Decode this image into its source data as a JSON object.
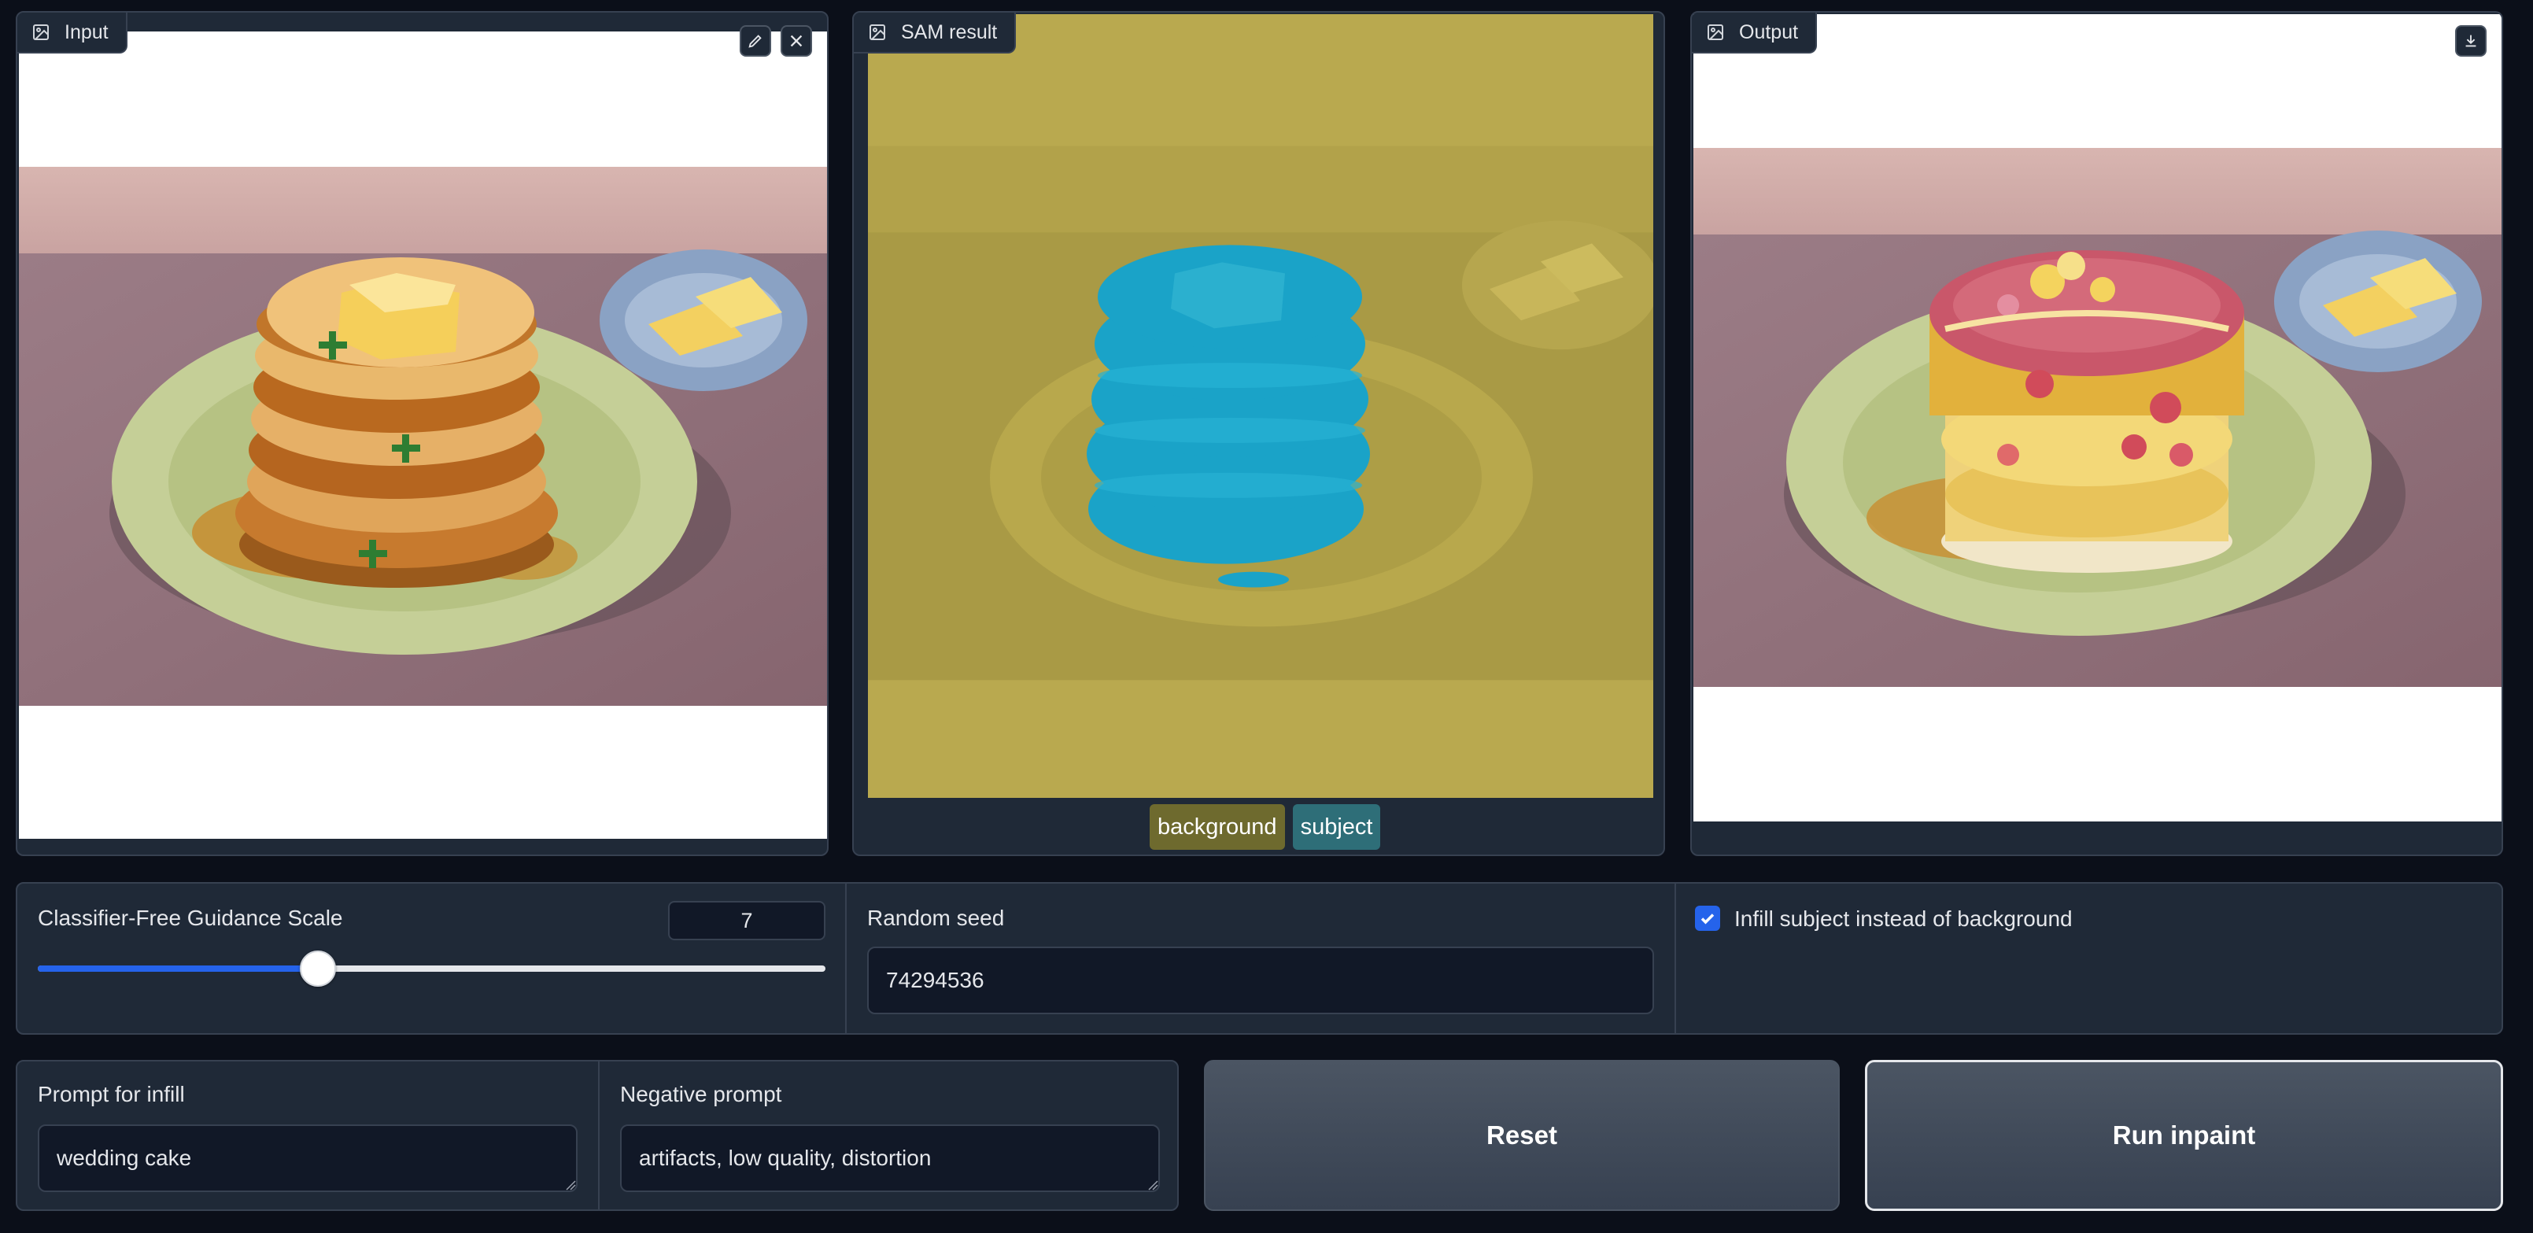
{
  "panels": {
    "input": {
      "label": "Input",
      "icon": "image-icon",
      "edit_icon": "pencil-icon",
      "clear_icon": "close-icon"
    },
    "sam": {
      "label": "SAM result",
      "icon": "image-icon"
    },
    "output": {
      "label": "Output",
      "icon": "image-icon",
      "download_icon": "download-icon"
    }
  },
  "sam_legend": [
    {
      "label": "background",
      "color": "#6e6a2e"
    },
    {
      "label": "subject",
      "color": "#2e6e78"
    }
  ],
  "controls": {
    "cfg": {
      "label": "Classifier-Free Guidance Scale",
      "value": "7",
      "fraction": 0.356
    },
    "seed": {
      "label": "Random seed",
      "value": "74294536"
    },
    "infill_subject": {
      "label": "Infill subject instead of background",
      "checked": true
    }
  },
  "prompts": {
    "infill": {
      "label": "Prompt for infill",
      "value": "wedding cake"
    },
    "negative": {
      "label": "Negative prompt",
      "value": "artifacts, low quality, distortion"
    }
  },
  "buttons": {
    "reset": "Reset",
    "run": "Run inpaint"
  },
  "colors": {
    "accent": "#2563eb",
    "background": "#0b0f19",
    "panel": "#1f2937",
    "border": "#374151",
    "sam_overlay": "#c8b84a",
    "subject_mask": "#1aa3c8",
    "marker": "#2e7d32"
  }
}
